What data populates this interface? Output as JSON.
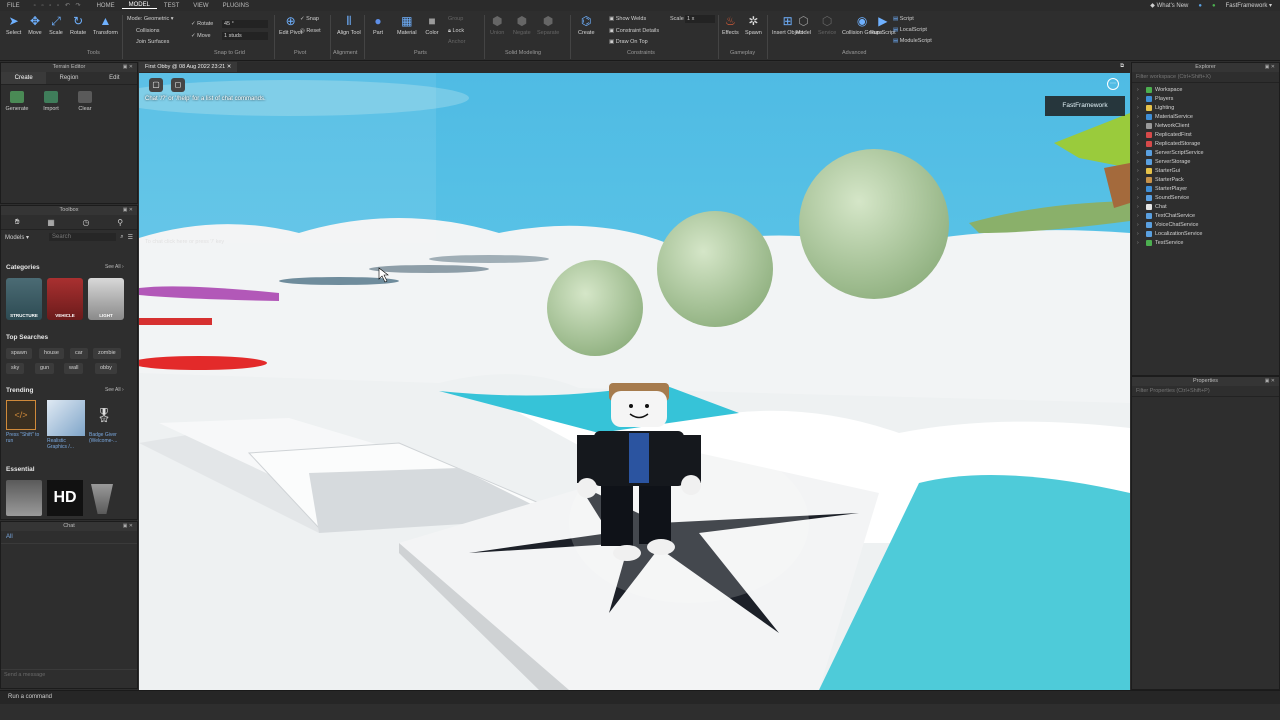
{
  "menubar": {
    "items": [
      "FILE",
      "HOME",
      "MODEL",
      "TEST",
      "VIEW",
      "PLUGINS"
    ],
    "active": "MODEL",
    "whats_new": "What's New",
    "user": "FastFramework"
  },
  "ribbon": {
    "tools": {
      "select": "Select",
      "move": "Move",
      "scale": "Scale",
      "rotate": "Rotate",
      "transform": "Transform",
      "group": "Tools"
    },
    "snap": {
      "mode_label": "Mode:",
      "mode_value": "Geometric",
      "collisions": "Collisions",
      "join_surfaces": "Join Surfaces",
      "rotate_label": "Rotate",
      "rotate_value": "45 °",
      "move_label": "Move",
      "move_value": "1 studs",
      "group": "Snap to Grid"
    },
    "pivot": {
      "edit_pivot": "Edit Pivot",
      "snap": "Snap",
      "reset": "Reset",
      "group": "Pivot"
    },
    "alignment": {
      "align_tool": "Align Tool",
      "group": "Alignment"
    },
    "parts": {
      "part": "Part",
      "material": "Material",
      "color": "Color",
      "group_btn": "Group",
      "lock": "Lock",
      "anchor": "Anchor",
      "group": "Parts"
    },
    "solid": {
      "union": "Union",
      "negate": "Negate",
      "separate": "Separate",
      "group": "Solid Modeling"
    },
    "constraints": {
      "create": "Create",
      "show_welds": "Show Welds",
      "constraint_details": "Constraint Details",
      "draw_on_top": "Draw On Top",
      "scale_label": "Scale",
      "scale_value": "1 x",
      "group": "Constraints"
    },
    "gameplay": {
      "effects": "Effects",
      "spawn": "Spawn",
      "group": "Gameplay"
    },
    "advanced": {
      "insert_object": "Insert Object",
      "model": "Model",
      "service": "Service",
      "collision_groups": "Collision Groups",
      "run_script": "Run Script",
      "script": "Script",
      "local_script": "LocalScript",
      "module_script": "ModuleScript",
      "group": "Advanced"
    }
  },
  "terrain": {
    "title": "Terrain Editor",
    "tabs": [
      "Create",
      "Region",
      "Edit"
    ],
    "actions": [
      "Generate",
      "Import",
      "Clear"
    ]
  },
  "toolbox": {
    "title": "Toolbox",
    "dropdown": "Models",
    "search_placeholder": "Search",
    "categories_title": "Categories",
    "see_all": "See All",
    "categories": [
      "STRUCTURE",
      "VEHICLE",
      "LIGHT"
    ],
    "top_searches_title": "Top Searches",
    "top_searches": [
      "spawn",
      "house",
      "car",
      "zombie",
      "sky",
      "gun",
      "wall",
      "obby"
    ],
    "trending_title": "Trending",
    "trending": [
      "Press \"Shift\" to run",
      "Realistic Graphics /...",
      "Badge Giver (Welcome-..."
    ],
    "essential_title": "Essential",
    "essential_hd": "HD"
  },
  "chat": {
    "title": "Chat",
    "tab": "All",
    "placeholder": "Send a message"
  },
  "command": {
    "placeholder": "Run a command"
  },
  "viewport": {
    "tab_title": "First Obby @ 08 Aug 2022 23:21",
    "chat_hint": "Chat '/?' or '/help' for a list of chat commands.",
    "chat_input": "To chat click here or press '/' key",
    "player_tag": "FastFramework"
  },
  "explorer": {
    "title": "Explorer",
    "filter": "Filter workspace (Ctrl+Shift+X)",
    "items": [
      {
        "name": "Workspace",
        "color": "#4caf50"
      },
      {
        "name": "Players",
        "color": "#3f8fd6"
      },
      {
        "name": "Lighting",
        "color": "#e6c24a"
      },
      {
        "name": "MaterialService",
        "color": "#3f8fd6"
      },
      {
        "name": "NetworkClient",
        "color": "#9a9a9a"
      },
      {
        "name": "ReplicatedFirst",
        "color": "#d64a4a"
      },
      {
        "name": "ReplicatedStorage",
        "color": "#d64a4a"
      },
      {
        "name": "ServerScriptService",
        "color": "#5aa0e0"
      },
      {
        "name": "ServerStorage",
        "color": "#5aa0e0"
      },
      {
        "name": "StarterGui",
        "color": "#e6c24a"
      },
      {
        "name": "StarterPack",
        "color": "#c8934a"
      },
      {
        "name": "StarterPlayer",
        "color": "#3f8fd6"
      },
      {
        "name": "SoundService",
        "color": "#5aa0e0"
      },
      {
        "name": "Chat",
        "color": "#e6e6e6"
      },
      {
        "name": "TextChatService",
        "color": "#5aa0e0"
      },
      {
        "name": "VoiceChatService",
        "color": "#5aa0e0"
      },
      {
        "name": "LocalizationService",
        "color": "#5aa0e0"
      },
      {
        "name": "TestService",
        "color": "#4caf50"
      }
    ]
  },
  "properties": {
    "title": "Properties",
    "filter": "Filter Properties (Ctrl+Shift+P)"
  }
}
